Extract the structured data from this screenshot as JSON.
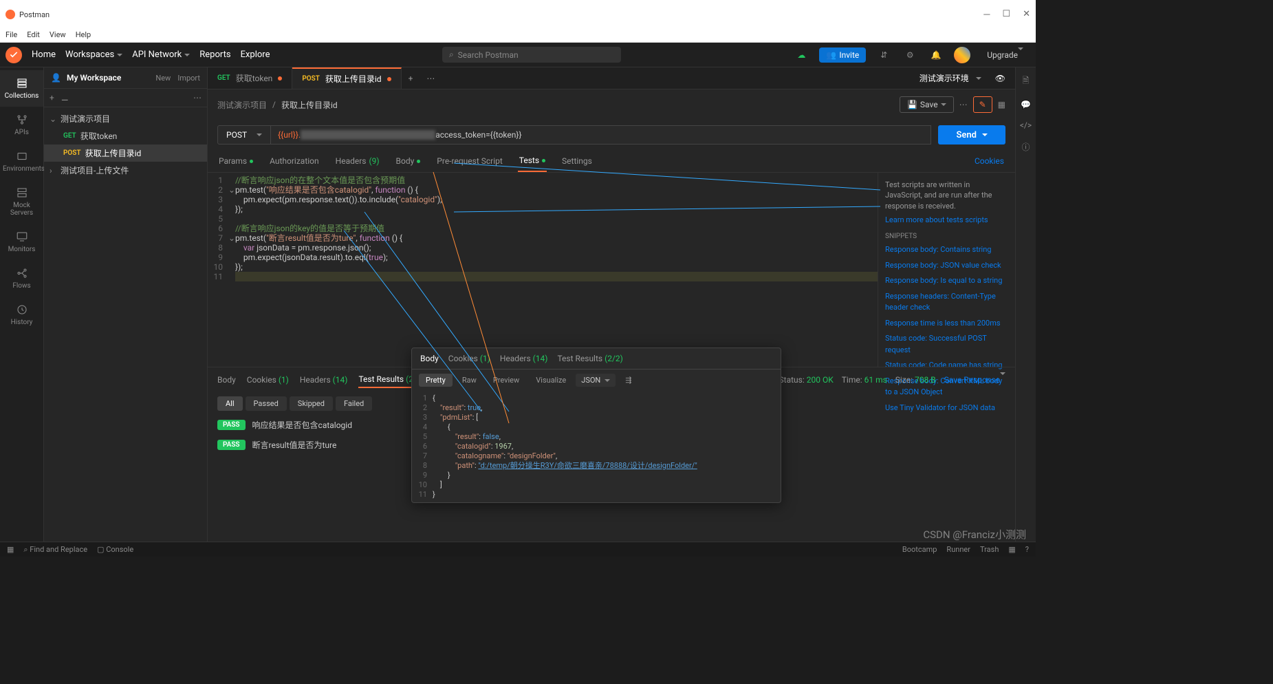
{
  "titlebar": {
    "app": "Postman"
  },
  "menubar": {
    "file": "File",
    "edit": "Edit",
    "view": "View",
    "help": "Help"
  },
  "topnav": {
    "home": "Home",
    "workspaces": "Workspaces",
    "api_network": "API Network",
    "reports": "Reports",
    "explore": "Explore",
    "search_placeholder": "Search Postman",
    "invite": "Invite",
    "upgrade": "Upgrade"
  },
  "leftbar": {
    "collections": "Collections",
    "apis": "APIs",
    "environments": "Environments",
    "mock_servers": "Mock Servers",
    "monitors": "Monitors",
    "flows": "Flows",
    "history": "History"
  },
  "sidebar": {
    "workspace": "My Workspace",
    "new": "New",
    "import": "Import",
    "tree": {
      "c0": {
        "name": "测试演示项目"
      },
      "r0": {
        "method": "GET",
        "name": "获取token"
      },
      "r1": {
        "method": "POST",
        "name": "获取上传目录id"
      },
      "c1": {
        "name": "测试项目-上传文件"
      }
    }
  },
  "tabs": {
    "t0": {
      "method": "GET",
      "name": "获取token"
    },
    "t1": {
      "method": "POST",
      "name": "获取上传目录id"
    },
    "env": "测试演示环境"
  },
  "breadcrumb": {
    "parent": "测试演示项目",
    "current": "获取上传目录id",
    "save": "Save"
  },
  "request": {
    "method": "POST",
    "url_prefix": "{{url}}.",
    "url_suffix": "access_token={{token}}",
    "send": "Send",
    "tabs": {
      "params": "Params",
      "auth": "Authorization",
      "headers": "Headers",
      "headers_count": "(9)",
      "body": "Body",
      "prereq": "Pre-request Script",
      "tests": "Tests",
      "settings": "Settings",
      "cookies": "Cookies"
    }
  },
  "code": {
    "l1": "//断言响应json的在整个文本值是否包含预期值",
    "l2a": "pm.test(",
    "l2b": "\"响应结果是否包含catalogid\"",
    "l2c": ", ",
    "l2d": "function",
    "l2e": " () {",
    "l3": "    pm.expect(pm.response.text()).to.include(",
    "l3b": "\"catalogid\"",
    "l3c": ");",
    "l4": "});",
    "l6": "//断言响应json的key的值是否等于预期值",
    "l7a": "pm.test(",
    "l7b": "\"断言result值是否为ture\"",
    "l7c": ", ",
    "l7d": "function",
    "l7e": " () {",
    "l8a": "    ",
    "l8b": "var",
    "l8c": " jsonData = pm.response.json();",
    "l9a": "    pm.expect(jsonData.result).to.eql(",
    "l9b": "true",
    "l9c": ");",
    "l10": "});"
  },
  "snippets": {
    "desc": "Test scripts are written in JavaScript, and are run after the response is received.",
    "learn": "Learn more about tests scripts",
    "title": "SNIPPETS",
    "s1": "Response body: Contains string",
    "s2": "Response body: JSON value check",
    "s3": "Response body: Is equal to a string",
    "s4": "Response headers: Content-Type header check",
    "s5": "Response time is less than 200ms",
    "s6": "Status code: Successful POST request",
    "s7": "Status code: Code name has string",
    "s8": "Response body: Convert XML body to a JSON Object",
    "s9": "Use Tiny Validator for JSON data"
  },
  "response": {
    "tabs": {
      "body": "Body",
      "cookies": "Cookies",
      "cookies_count": "(1)",
      "headers": "Headers",
      "headers_count": "(14)",
      "test_results": "Test Results",
      "tr_count": "(2/2)"
    },
    "status": {
      "label": "Status:",
      "value": "200 OK",
      "time_label": "Time:",
      "time_value": "61 ms",
      "size_label": "Size:",
      "size_value": "708 B",
      "save": "Save Response"
    },
    "filters": {
      "all": "All",
      "passed": "Passed",
      "skipped": "Skipped",
      "failed": "Failed"
    },
    "tests": {
      "t0": {
        "status": "PASS",
        "name": "响应结果是否包含catalogid"
      },
      "t1": {
        "status": "PASS",
        "name": "断言result值是否为ture"
      }
    }
  },
  "popup": {
    "tabs": {
      "body": "Body",
      "cookies": "Cookies",
      "cookies_count": "(1)",
      "headers": "Headers",
      "headers_count": "(14)",
      "test_results": "Test Results",
      "tr_count": "(2/2)"
    },
    "views": {
      "pretty": "Pretty",
      "raw": "Raw",
      "preview": "Preview",
      "visualize": "Visualize",
      "json": "JSON"
    },
    "json": {
      "result_key": "\"result\"",
      "result_val": "true",
      "pdm_key": "\"pdmList\"",
      "inner_result_key": "\"result\"",
      "inner_result_val": "false",
      "catalogid_key": "\"catalogid\"",
      "catalogid_val": "1967",
      "catalogname_key": "\"catalogname\"",
      "catalogname_val": "\"designFolder\"",
      "path_key": "\"path\"",
      "path_val": "\"d:/temp/朝分操生R3Y/命欲三磨喜亲/78888/设计/designFolder/\""
    }
  },
  "bottombar": {
    "find": "Find and Replace",
    "console": "Console",
    "bootcamp": "Bootcamp",
    "runner": "Runner",
    "trash": "Trash"
  },
  "watermark": "CSDN @Franciz小测测"
}
